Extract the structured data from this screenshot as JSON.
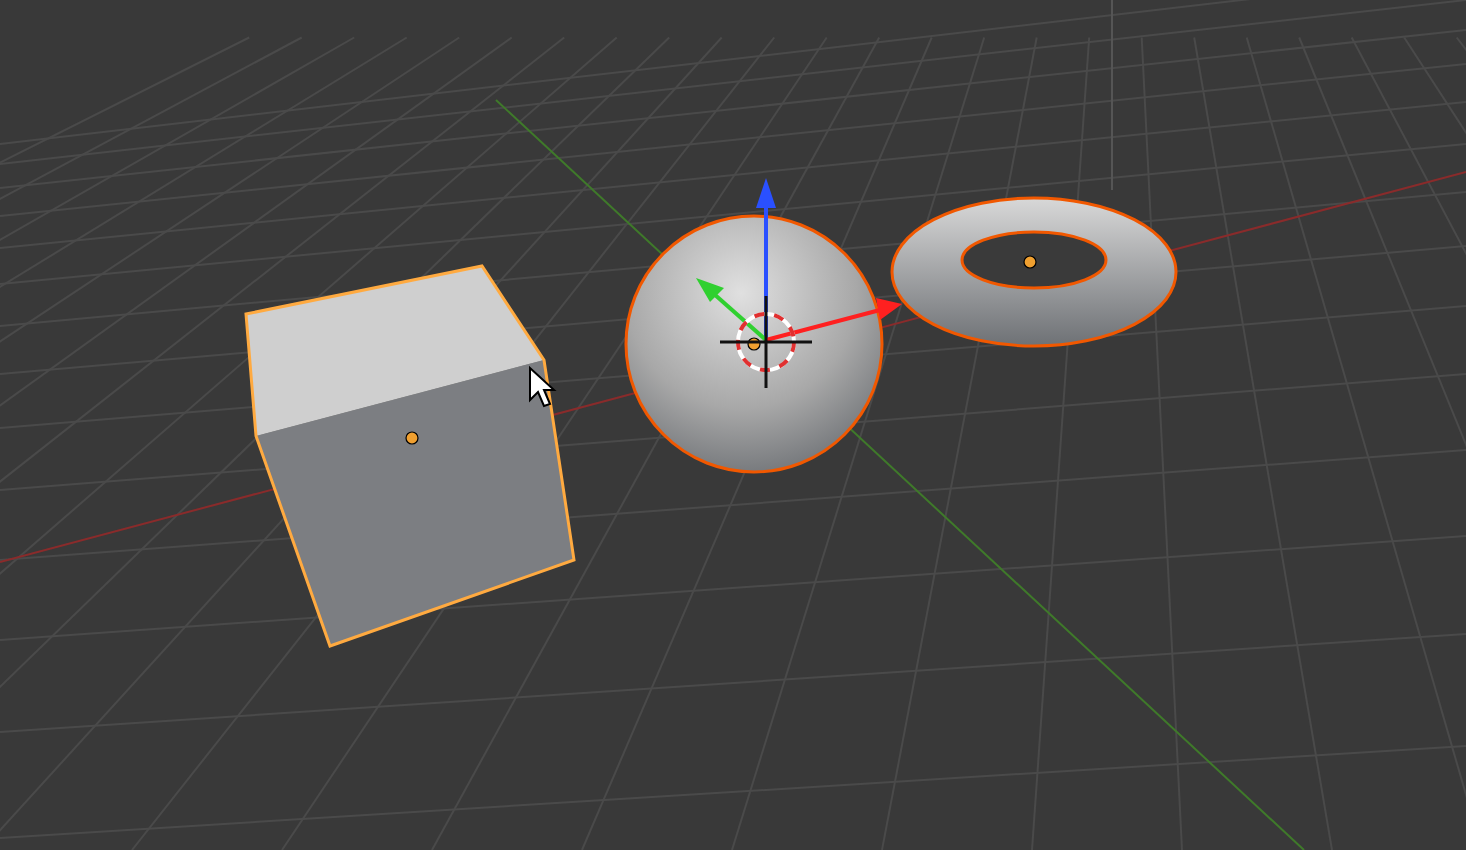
{
  "viewport": {
    "objects": [
      {
        "kind": "cube",
        "selected": true,
        "active": true
      },
      {
        "kind": "sphere",
        "selected": true,
        "active": false
      },
      {
        "kind": "torus",
        "selected": true,
        "active": false
      }
    ]
  }
}
